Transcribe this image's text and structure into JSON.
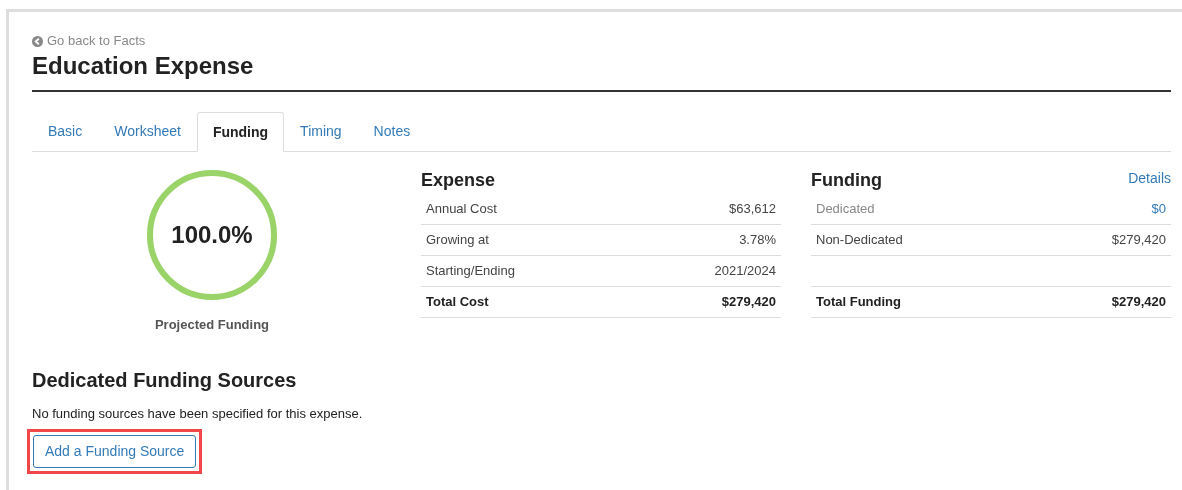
{
  "back_link": "Go back to Facts",
  "title": "Education Expense",
  "tabs": [
    {
      "label": "Basic",
      "selected": false
    },
    {
      "label": "Worksheet",
      "selected": false
    },
    {
      "label": "Funding",
      "selected": true
    },
    {
      "label": "Timing",
      "selected": false
    },
    {
      "label": "Notes",
      "selected": false
    }
  ],
  "gauge": {
    "reading": "100.0%",
    "level": 1,
    "caption": "Projected Funding"
  },
  "expense": {
    "heading": "Expense",
    "rows": [
      {
        "kind": "normal",
        "label": "Annual Cost",
        "value": "$63,612"
      },
      {
        "kind": "normal",
        "label": "Growing at",
        "value": "3.78%"
      },
      {
        "kind": "normal",
        "label": "Starting/Ending",
        "value": "2021/2024"
      },
      {
        "kind": "total",
        "label": "Total Cost",
        "value": "$279,420"
      }
    ]
  },
  "funding": {
    "heading": "Funding",
    "details_link": "Details",
    "rows": [
      {
        "kind": "link",
        "label": "Dedicated",
        "value": "$0"
      },
      {
        "kind": "normal",
        "label": "Non-Dedicated",
        "value": "$279,420"
      },
      {
        "kind": "empty"
      },
      {
        "kind": "total",
        "label": "Total Funding",
        "value": "$279,420"
      }
    ]
  },
  "sources": {
    "heading": "Dedicated Funding Sources",
    "message": "No funding sources have been specified for this expense.",
    "button": {
      "label": "Add a Funding Source",
      "highlighted": true
    }
  }
}
